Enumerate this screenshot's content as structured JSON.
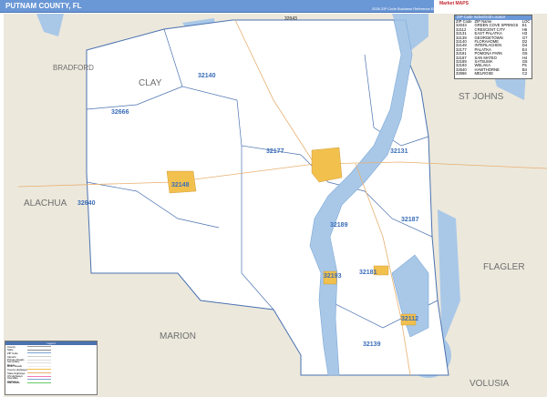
{
  "header": {
    "title": "PUTNAM COUNTY, FL",
    "edition": "2026 ZIP Code Business Reference Edition",
    "logo": "Market MAPS"
  },
  "colors": {
    "header": "#6a97d6",
    "water": "#a9c8e8",
    "land_outside": "#ece8dc",
    "county": "#ffffff",
    "city": "#f2c04d",
    "zip_boundary": "#4a72b0"
  },
  "locator": {
    "title": "ZIP Code Index/Grid Locator",
    "columns": [
      "ZIP Code",
      "ZIP Name",
      "LOC"
    ],
    "rows": [
      [
        "32043",
        "GREEN COVE SPRINGS",
        "E1"
      ],
      [
        "32112",
        "CRESCENT CITY",
        "H6"
      ],
      [
        "32131",
        "EAST PALATKA",
        "H3"
      ],
      [
        "32139",
        "GEORGETOWN",
        "G7"
      ],
      [
        "32140",
        "FLORAHOME",
        "D2"
      ],
      [
        "32148",
        "INTERLACHEN",
        "D4"
      ],
      [
        "32177",
        "PALATKA",
        "E4"
      ],
      [
        "32181",
        "POMONA PARK",
        "G5"
      ],
      [
        "32187",
        "SAN MATEO",
        "H4"
      ],
      [
        "32189",
        "SATSUMA",
        "G5"
      ],
      [
        "32193",
        "WELAKA",
        "F5"
      ],
      [
        "32640",
        "HAWTHORNE",
        "B4"
      ],
      [
        "32666",
        "MELROSE",
        "C2"
      ]
    ]
  },
  "neighbors": [
    "BRADFORD",
    "CLAY",
    "ST JOHNS",
    "ALACHUA",
    "FLAGLER",
    "MARION",
    "VOLUSIA"
  ],
  "zips": [
    {
      "code": "32043"
    },
    {
      "code": "32140"
    },
    {
      "code": "32666"
    },
    {
      "code": "32177"
    },
    {
      "code": "32131"
    },
    {
      "code": "32148"
    },
    {
      "code": "32640"
    },
    {
      "code": "32187"
    },
    {
      "code": "32189"
    },
    {
      "code": "32193"
    },
    {
      "code": "32181"
    },
    {
      "code": "32112"
    },
    {
      "code": "32139"
    }
  ],
  "legend": {
    "title": "Legend",
    "items": [
      "County",
      "State",
      "ZIP Code",
      "Airports",
      "Primary Roads",
      "Secondary Roads",
      "Minor Roads",
      "County Highways",
      "State Highways",
      "US Highways",
      "Interstate Highways",
      "Rail Roads"
    ]
  }
}
